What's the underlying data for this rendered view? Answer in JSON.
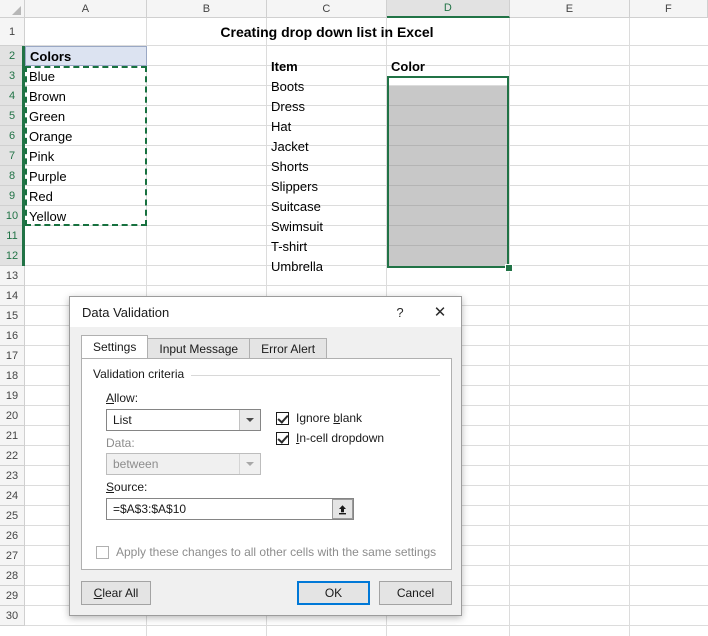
{
  "spreadsheet": {
    "column_headers": [
      "A",
      "B",
      "C",
      "D",
      "E",
      "F"
    ],
    "active_column": "D",
    "row_headers": [
      "1",
      "2",
      "3",
      "4",
      "5",
      "6",
      "7",
      "8",
      "9",
      "10",
      "11",
      "12",
      "13",
      "14",
      "15",
      "16",
      "17",
      "18",
      "19",
      "20",
      "21",
      "22",
      "23",
      "24",
      "25",
      "26",
      "27",
      "28",
      "29",
      "30"
    ],
    "active_rows": [
      "2",
      "3",
      "4",
      "5",
      "6",
      "7",
      "8",
      "9",
      "10",
      "11",
      "12"
    ],
    "title": "Creating drop down list in Excel",
    "col_a": {
      "header": "Colors",
      "values": [
        "Blue",
        "Brown",
        "Green",
        "Orange",
        "Pink",
        "Purple",
        "Red",
        "Yellow"
      ]
    },
    "col_c": {
      "header": "Item",
      "values": [
        "Boots",
        "Dress",
        "Hat",
        "Jacket",
        "Shorts",
        "Slippers",
        "Suitcase",
        "Swimsuit",
        "T-shirt",
        "Umbrella"
      ]
    },
    "col_d": {
      "header": "Color",
      "values": [
        "",
        "",
        "",
        "",
        "",
        "",
        "",
        "",
        "",
        ""
      ]
    },
    "colors": {
      "selection_green": "#217346",
      "selection_fill": "#C8C8C8",
      "header_cell_fill": "#DCE3F1",
      "gridline": "#DCDCDC"
    }
  },
  "dialog": {
    "title": "Data Validation",
    "help_icon": "?",
    "close_icon": "✕",
    "tabs": [
      {
        "label": "Settings",
        "active": true
      },
      {
        "label": "Input Message",
        "active": false
      },
      {
        "label": "Error Alert",
        "active": false
      }
    ],
    "group_label": "Validation criteria",
    "allow_label": "Allow:",
    "allow_label_accel": "A",
    "allow_value": "List",
    "data_label": "Data:",
    "data_value": "between",
    "source_label": "Source:",
    "source_label_accel": "S",
    "source_value": "=$A$3:$A$10",
    "source_picker_icon": "range-select-up-arrow",
    "checkboxes": [
      {
        "label_pre": "Ignore ",
        "label_accel": "b",
        "label_post": "lank",
        "checked": true,
        "disabled": false
      },
      {
        "label_pre": "",
        "label_accel": "I",
        "label_post": "n-cell dropdown",
        "checked": true,
        "disabled": false
      }
    ],
    "apply_all_label": "Apply these changes to all other cells with the same settings",
    "apply_all_checked": false,
    "buttons": {
      "clear_all_pre": "",
      "clear_all_accel": "C",
      "clear_all_post": "lear All",
      "ok": "OK",
      "cancel": "Cancel",
      "focused": "OK"
    },
    "accent": "#0078D7"
  }
}
